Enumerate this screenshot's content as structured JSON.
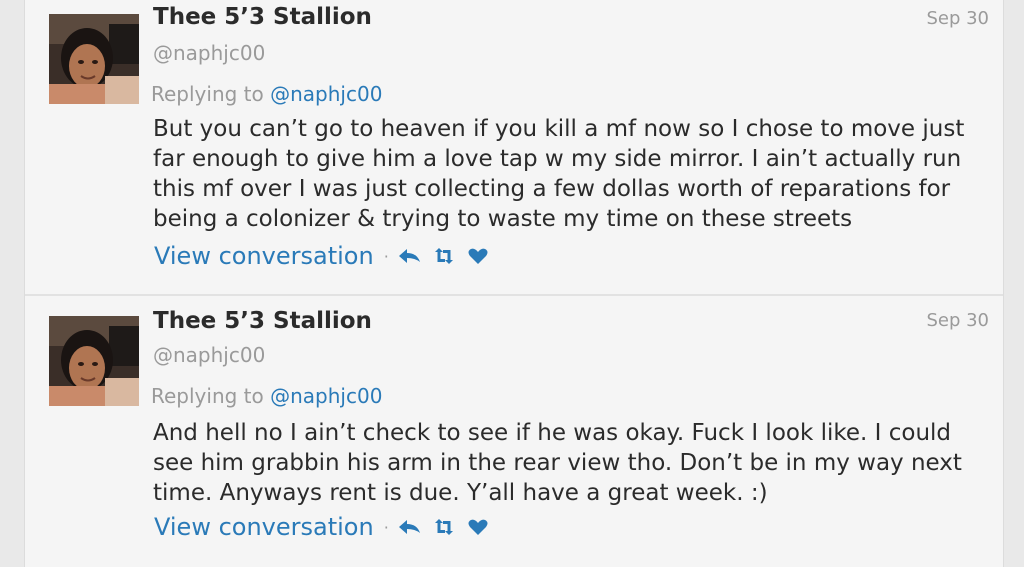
{
  "tweets": [
    {
      "author_name": "Thee 5’3 Stallion",
      "handle": "@naphjc00",
      "date": "Sep 30",
      "replying_prefix": "Replying to ",
      "replying_handle": "@naphjc00",
      "text": "But you can’t go to heaven if you kill a mf now so I chose to move just far enough to give him a love tap w my side mirror. I ain’t actually run this mf over I was just collecting a few dollas worth of reparations for being a colonizer & trying to waste my time on these streets",
      "view_conversation": "View conversation",
      "separator": "·"
    },
    {
      "author_name": "Thee 5’3 Stallion",
      "handle": "@naphjc00",
      "date": "Sep 30",
      "replying_prefix": "Replying to ",
      "replying_handle": "@naphjc00",
      "text": "And hell no I ain’t check to see if he was okay. Fuck I look like. I could see him grabbin his arm in the rear view tho. Don’t be in my way next time. Anyways rent is due. Y’all have a great week. :)",
      "view_conversation": "View conversation",
      "separator": "·"
    }
  ],
  "icons": {
    "reply": "reply-icon",
    "retweet": "retweet-icon",
    "like": "heart-icon"
  },
  "colors": {
    "link": "#2a7ab8",
    "muted": "#9a9a9a",
    "text": "#2b2b2b",
    "background": "#f5f5f5"
  }
}
